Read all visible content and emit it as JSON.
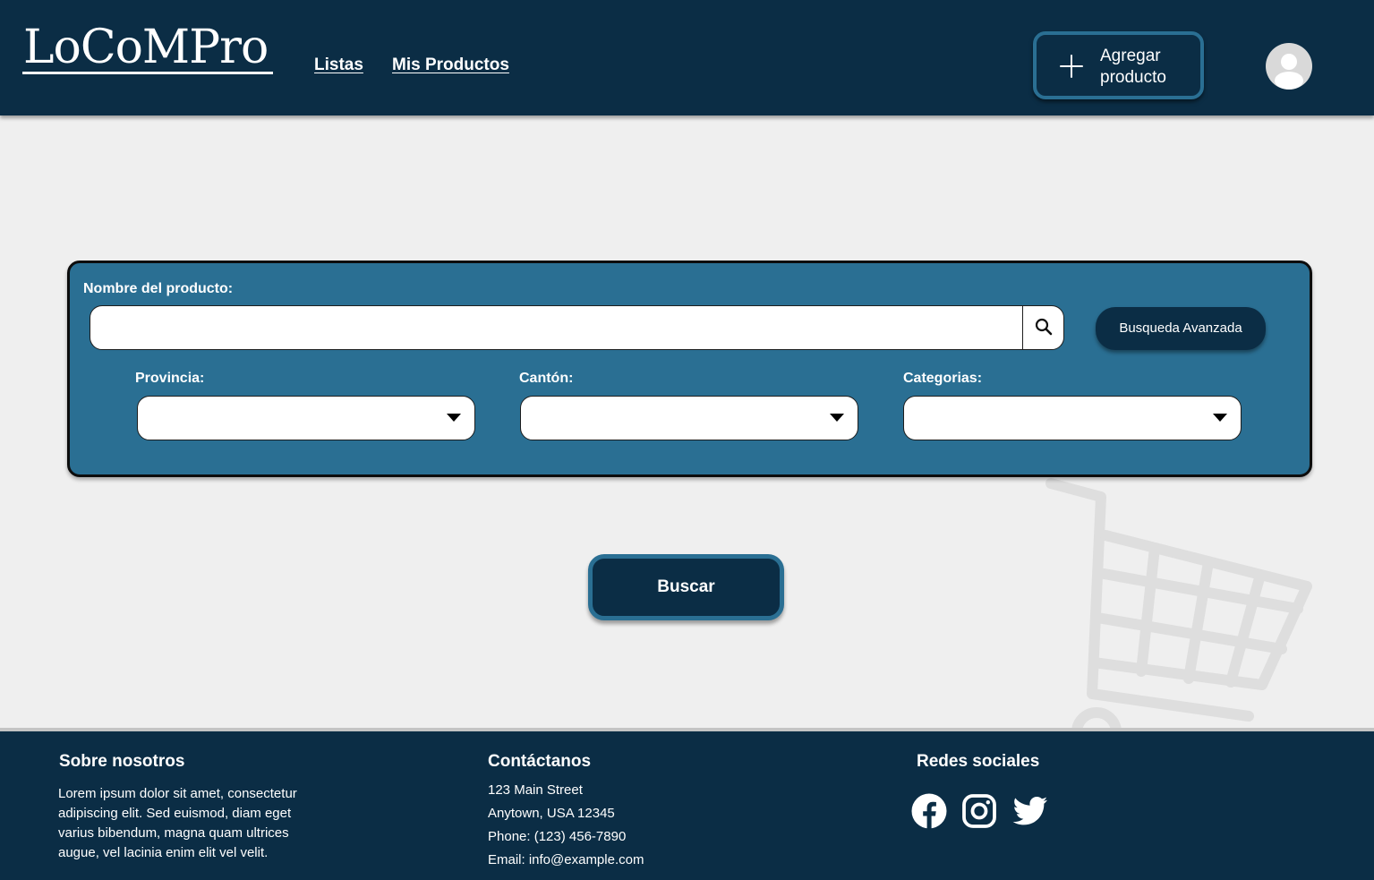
{
  "header": {
    "logo": "LoCoMPro",
    "nav": [
      {
        "label": "Listas"
      },
      {
        "label": "Mis Productos"
      }
    ],
    "add_product_label": "Agregar producto",
    "add_icon": "plus-icon",
    "avatar_icon": "user-avatar-icon"
  },
  "search": {
    "product_label": "Nombre del producto:",
    "product_value": "",
    "product_placeholder": "",
    "search_icon": "magnifier-icon",
    "advanced_label": "Busqueda Avanzada",
    "filters": [
      {
        "label": "Provincia:",
        "value": ""
      },
      {
        "label": "Cantón:",
        "value": ""
      },
      {
        "label": "Categorias:",
        "value": ""
      }
    ],
    "submit_label": "Buscar"
  },
  "footer": {
    "about_heading": "Sobre nosotros",
    "about_text": "Lorem ipsum dolor sit amet, consectetur adipiscing elit. Sed euismod, diam eget varius bibendum, magna quam ultrices augue, vel lacinia enim elit vel velit.",
    "contact_heading": "Contáctanos",
    "contact_lines": [
      "123 Main Street",
      "Anytown, USA 12345",
      "Phone: (123) 456-7890",
      "Email: info@example.com"
    ],
    "social_heading": "Redes sociales",
    "social_icons": [
      "facebook-icon",
      "instagram-icon",
      "twitter-icon"
    ]
  },
  "colors": {
    "header_bg": "#0b2d45",
    "panel_bg": "#2a6f93",
    "page_bg": "#efefef",
    "accent_border": "#2a6f93",
    "text_light": "#ffffff"
  }
}
